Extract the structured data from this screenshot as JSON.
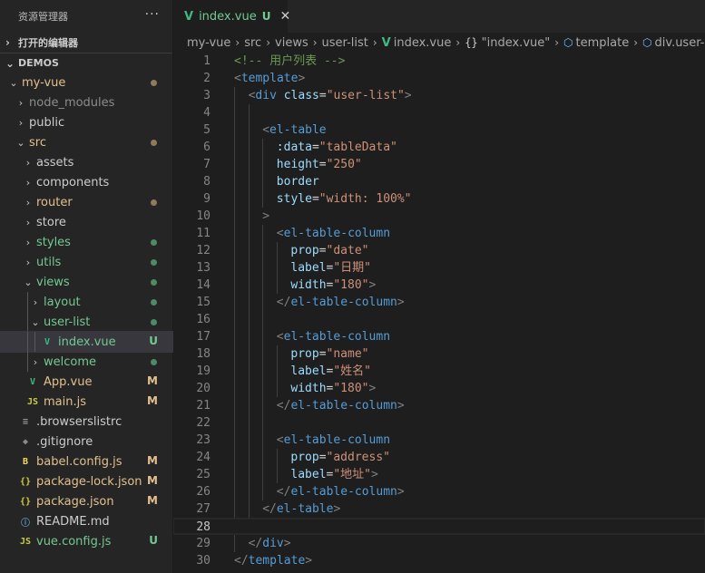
{
  "explorer": {
    "title": "资源管理器",
    "more": "···",
    "open_editors": "打开的编辑器",
    "workspace": "DEMOS",
    "items": [
      {
        "label": "my-vue",
        "depth": 0,
        "kind": "folder-open",
        "color": "c-mod",
        "deco": "dot",
        "deco_color": "#8d7b5c"
      },
      {
        "label": "node_modules",
        "depth": 1,
        "kind": "folder",
        "color": "c-ignored"
      },
      {
        "label": "public",
        "depth": 1,
        "kind": "folder",
        "color": "c-norm"
      },
      {
        "label": "src",
        "depth": 1,
        "kind": "folder-open",
        "color": "c-mod",
        "deco": "dot",
        "deco_color": "#8d7b5c"
      },
      {
        "label": "assets",
        "depth": 2,
        "kind": "folder",
        "color": "c-norm"
      },
      {
        "label": "components",
        "depth": 2,
        "kind": "folder",
        "color": "c-norm"
      },
      {
        "label": "router",
        "depth": 2,
        "kind": "folder",
        "color": "c-mod",
        "deco": "dot",
        "deco_color": "#8d7b5c"
      },
      {
        "label": "store",
        "depth": 2,
        "kind": "folder",
        "color": "c-norm"
      },
      {
        "label": "styles",
        "depth": 2,
        "kind": "folder",
        "color": "c-new",
        "deco": "dot",
        "deco_color": "#4e8a63"
      },
      {
        "label": "utils",
        "depth": 2,
        "kind": "folder",
        "color": "c-new",
        "deco": "dot",
        "deco_color": "#4e8a63"
      },
      {
        "label": "views",
        "depth": 2,
        "kind": "folder-open",
        "color": "c-new",
        "deco": "dot",
        "deco_color": "#4e8a63"
      },
      {
        "label": "layout",
        "depth": 3,
        "kind": "folder",
        "color": "c-new",
        "deco": "dot",
        "deco_color": "#4e8a63"
      },
      {
        "label": "user-list",
        "depth": 3,
        "kind": "folder-open",
        "color": "c-new",
        "deco": "dot",
        "deco_color": "#4e8a63"
      },
      {
        "label": "index.vue",
        "depth": 4,
        "kind": "vue",
        "color": "c-new",
        "deco": "letter",
        "deco_text": "U",
        "selected": true
      },
      {
        "label": "welcome",
        "depth": 3,
        "kind": "folder",
        "color": "c-new",
        "deco": "dot",
        "deco_color": "#4e8a63"
      },
      {
        "label": "App.vue",
        "depth": 2,
        "kind": "vue",
        "color": "c-mod",
        "deco": "letter",
        "deco_text": "M"
      },
      {
        "label": "main.js",
        "depth": 2,
        "kind": "js",
        "color": "c-mod",
        "deco": "letter",
        "deco_text": "M"
      },
      {
        "label": ".browserslistrc",
        "depth": 1,
        "kind": "list",
        "color": "c-norm"
      },
      {
        "label": ".gitignore",
        "depth": 1,
        "kind": "git",
        "color": "c-norm"
      },
      {
        "label": "babel.config.js",
        "depth": 1,
        "kind": "babel",
        "color": "c-mod",
        "deco": "letter",
        "deco_text": "M"
      },
      {
        "label": "package-lock.json",
        "depth": 1,
        "kind": "json",
        "color": "c-mod",
        "deco": "letter",
        "deco_text": "M"
      },
      {
        "label": "package.json",
        "depth": 1,
        "kind": "json",
        "color": "c-mod",
        "deco": "letter",
        "deco_text": "M"
      },
      {
        "label": "README.md",
        "depth": 1,
        "kind": "info",
        "color": "c-norm"
      },
      {
        "label": "vue.config.js",
        "depth": 1,
        "kind": "js",
        "color": "c-new",
        "deco": "letter",
        "deco_text": "U"
      }
    ]
  },
  "tab": {
    "label": "index.vue",
    "status": "U",
    "close": "✕"
  },
  "breadcrumb": [
    "my-vue",
    "src",
    "views",
    "user-list",
    "index.vue",
    "\"index.vue\"",
    "template",
    "div.user-list"
  ],
  "editor": {
    "current_line": 28,
    "lines": [
      {
        "n": 1,
        "i": 0,
        "t": [
          [
            "cm",
            "<!-- 用户列表 -->"
          ]
        ]
      },
      {
        "n": 2,
        "i": 0,
        "t": [
          [
            "br",
            "<"
          ],
          [
            "tag",
            "template"
          ],
          [
            "br",
            ">"
          ]
        ]
      },
      {
        "n": 3,
        "i": 1,
        "t": [
          [
            "br",
            "<"
          ],
          [
            "tag",
            "div"
          ],
          [
            "eq",
            " "
          ],
          [
            "at",
            "class"
          ],
          [
            "eq",
            "="
          ],
          [
            "st",
            "\"user-list\""
          ],
          [
            "br",
            ">"
          ]
        ]
      },
      {
        "n": 4,
        "i": 2,
        "t": []
      },
      {
        "n": 5,
        "i": 2,
        "t": [
          [
            "br",
            "<"
          ],
          [
            "tag",
            "el-table"
          ]
        ]
      },
      {
        "n": 6,
        "i": 3,
        "t": [
          [
            "at",
            ":data"
          ],
          [
            "eq",
            "="
          ],
          [
            "st",
            "\"tableData\""
          ]
        ]
      },
      {
        "n": 7,
        "i": 3,
        "t": [
          [
            "at",
            "height"
          ],
          [
            "eq",
            "="
          ],
          [
            "st",
            "\"250\""
          ]
        ]
      },
      {
        "n": 8,
        "i": 3,
        "t": [
          [
            "at",
            "border"
          ]
        ]
      },
      {
        "n": 9,
        "i": 3,
        "t": [
          [
            "at",
            "style"
          ],
          [
            "eq",
            "="
          ],
          [
            "st",
            "\"width: 100%\""
          ]
        ]
      },
      {
        "n": 10,
        "i": 2,
        "t": [
          [
            "br",
            ">"
          ]
        ]
      },
      {
        "n": 11,
        "i": 3,
        "t": [
          [
            "br",
            "<"
          ],
          [
            "tag",
            "el-table-column"
          ]
        ]
      },
      {
        "n": 12,
        "i": 4,
        "t": [
          [
            "at",
            "prop"
          ],
          [
            "eq",
            "="
          ],
          [
            "st",
            "\"date\""
          ]
        ]
      },
      {
        "n": 13,
        "i": 4,
        "t": [
          [
            "at",
            "label"
          ],
          [
            "eq",
            "="
          ],
          [
            "st",
            "\"日期\""
          ]
        ]
      },
      {
        "n": 14,
        "i": 4,
        "t": [
          [
            "at",
            "width"
          ],
          [
            "eq",
            "="
          ],
          [
            "st",
            "\"180\""
          ],
          [
            "br",
            ">"
          ]
        ]
      },
      {
        "n": 15,
        "i": 3,
        "t": [
          [
            "br",
            "</"
          ],
          [
            "tag",
            "el-table-column"
          ],
          [
            "br",
            ">"
          ]
        ]
      },
      {
        "n": 16,
        "i": 3,
        "t": []
      },
      {
        "n": 17,
        "i": 3,
        "t": [
          [
            "br",
            "<"
          ],
          [
            "tag",
            "el-table-column"
          ]
        ]
      },
      {
        "n": 18,
        "i": 4,
        "t": [
          [
            "at",
            "prop"
          ],
          [
            "eq",
            "="
          ],
          [
            "st",
            "\"name\""
          ]
        ]
      },
      {
        "n": 19,
        "i": 4,
        "t": [
          [
            "at",
            "label"
          ],
          [
            "eq",
            "="
          ],
          [
            "st",
            "\"姓名\""
          ]
        ]
      },
      {
        "n": 20,
        "i": 4,
        "t": [
          [
            "at",
            "width"
          ],
          [
            "eq",
            "="
          ],
          [
            "st",
            "\"180\""
          ],
          [
            "br",
            ">"
          ]
        ]
      },
      {
        "n": 21,
        "i": 3,
        "t": [
          [
            "br",
            "</"
          ],
          [
            "tag",
            "el-table-column"
          ],
          [
            "br",
            ">"
          ]
        ]
      },
      {
        "n": 22,
        "i": 3,
        "t": []
      },
      {
        "n": 23,
        "i": 3,
        "t": [
          [
            "br",
            "<"
          ],
          [
            "tag",
            "el-table-column"
          ]
        ]
      },
      {
        "n": 24,
        "i": 4,
        "t": [
          [
            "at",
            "prop"
          ],
          [
            "eq",
            "="
          ],
          [
            "st",
            "\"address\""
          ]
        ]
      },
      {
        "n": 25,
        "i": 4,
        "t": [
          [
            "at",
            "label"
          ],
          [
            "eq",
            "="
          ],
          [
            "st",
            "\"地址\""
          ],
          [
            "br",
            ">"
          ]
        ]
      },
      {
        "n": 26,
        "i": 3,
        "t": [
          [
            "br",
            "</"
          ],
          [
            "tag",
            "el-table-column"
          ],
          [
            "br",
            ">"
          ]
        ]
      },
      {
        "n": 27,
        "i": 2,
        "t": [
          [
            "br",
            "</"
          ],
          [
            "tag",
            "el-table"
          ],
          [
            "br",
            ">"
          ]
        ]
      },
      {
        "n": 28,
        "i": 0,
        "t": []
      },
      {
        "n": 29,
        "i": 1,
        "t": [
          [
            "br",
            "</"
          ],
          [
            "tag",
            "div"
          ],
          [
            "br",
            ">"
          ]
        ]
      },
      {
        "n": 30,
        "i": 0,
        "t": [
          [
            "br",
            "</"
          ],
          [
            "tag",
            "template"
          ],
          [
            "br",
            ">"
          ]
        ]
      }
    ]
  }
}
